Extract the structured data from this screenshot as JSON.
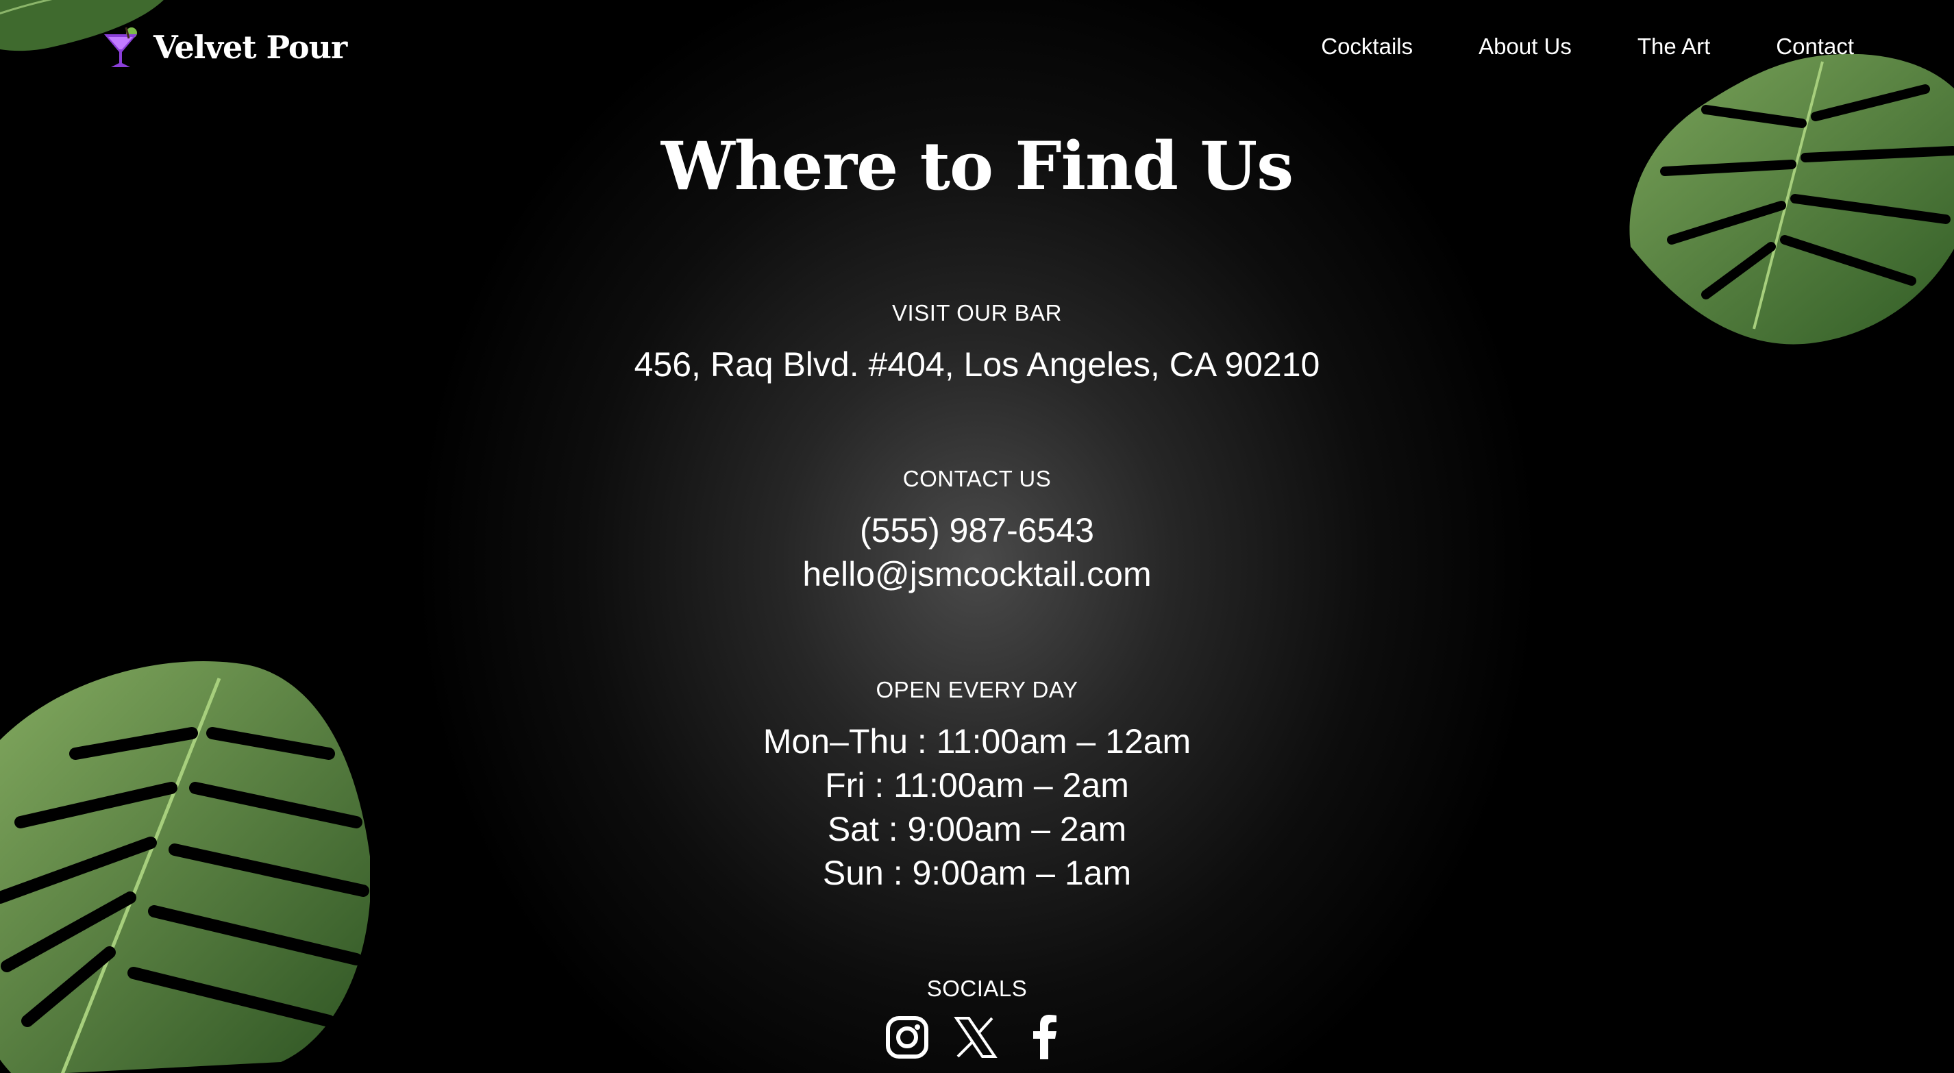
{
  "header": {
    "brand": "Velvet Pour",
    "nav": [
      "Cocktails",
      "About Us",
      "The Art",
      "Contact"
    ]
  },
  "main": {
    "title": "Where to Find Us",
    "visit": {
      "label": "VISIT OUR BAR",
      "address": "456, Raq Blvd. #404, Los Angeles, CA 90210"
    },
    "contact": {
      "label": "CONTACT US",
      "phone": "(555) 987-6543",
      "email": "hello@jsmcocktail.com"
    },
    "hours": {
      "label": "OPEN EVERY DAY",
      "lines": [
        "Mon–Thu : 11:00am – 12am",
        "Fri : 11:00am – 2am",
        "Sat : 9:00am – 2am",
        "Sun : 9:00am – 1am"
      ]
    },
    "socials": {
      "label": "SOCIALS",
      "icons": [
        "instagram-icon",
        "x-icon",
        "facebook-icon"
      ]
    }
  },
  "colors": {
    "background": "#000000",
    "text": "#ffffff",
    "leaf_green": "#4f7a3a",
    "logo_purple": "#8b3fd9"
  }
}
